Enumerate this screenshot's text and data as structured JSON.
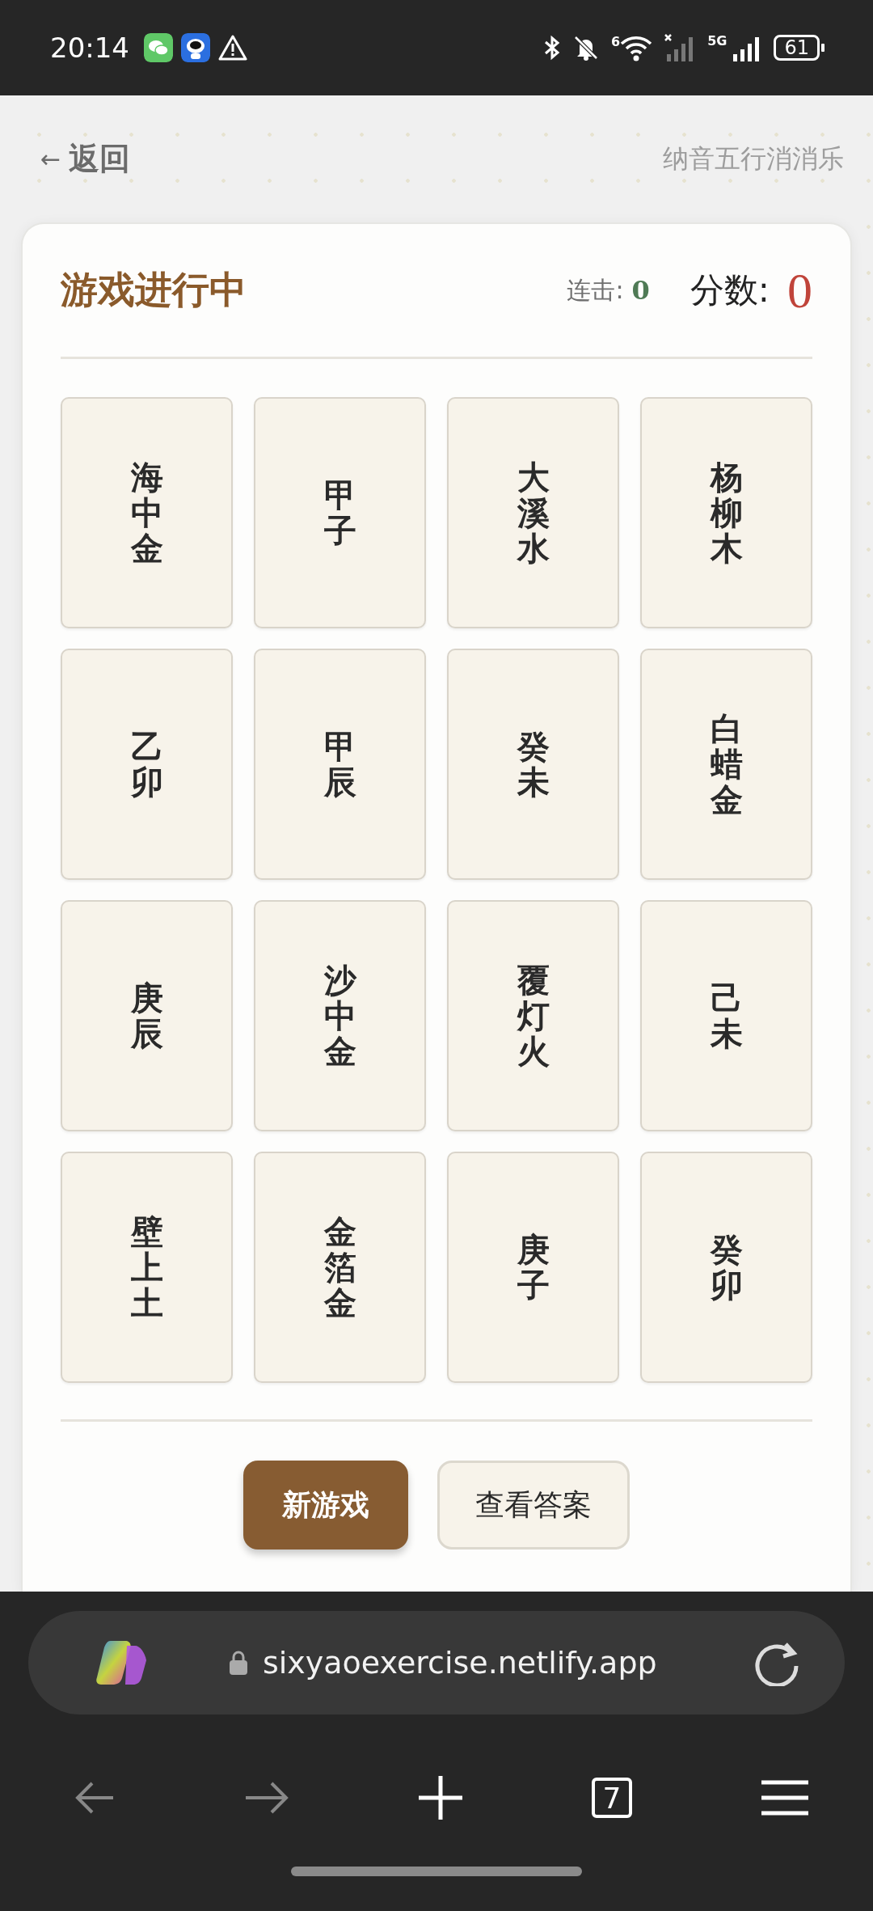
{
  "status_bar": {
    "time": "20:14",
    "wifi_label": "6",
    "network_label": "5G",
    "battery": "61"
  },
  "header": {
    "back": "←",
    "back_label": "返回",
    "title": "纳音五行消消乐"
  },
  "game": {
    "status": "游戏进行中",
    "combo_label": "连击:",
    "combo": "0",
    "score_label": "分数:",
    "score": "0",
    "tiles": [
      {
        "text": "海中金"
      },
      {
        "text": "甲子"
      },
      {
        "text": "大溪水"
      },
      {
        "text": "杨柳木"
      },
      {
        "text": "乙卯"
      },
      {
        "text": "甲辰"
      },
      {
        "text": "癸未"
      },
      {
        "text": "白蜡金"
      },
      {
        "text": "庚辰"
      },
      {
        "text": "沙中金"
      },
      {
        "text": "覆灯火"
      },
      {
        "text": "己未"
      },
      {
        "text": "壁上土"
      },
      {
        "text": "金箔金"
      },
      {
        "text": "庚子"
      },
      {
        "text": "癸卯"
      }
    ],
    "buttons": [
      {
        "label": "新游戏",
        "kind": "primary"
      },
      {
        "label": "查看答案",
        "kind": "secondary"
      }
    ]
  },
  "browser": {
    "url": "sixyaoexercise.netlify.app",
    "tab_count": "7"
  }
}
